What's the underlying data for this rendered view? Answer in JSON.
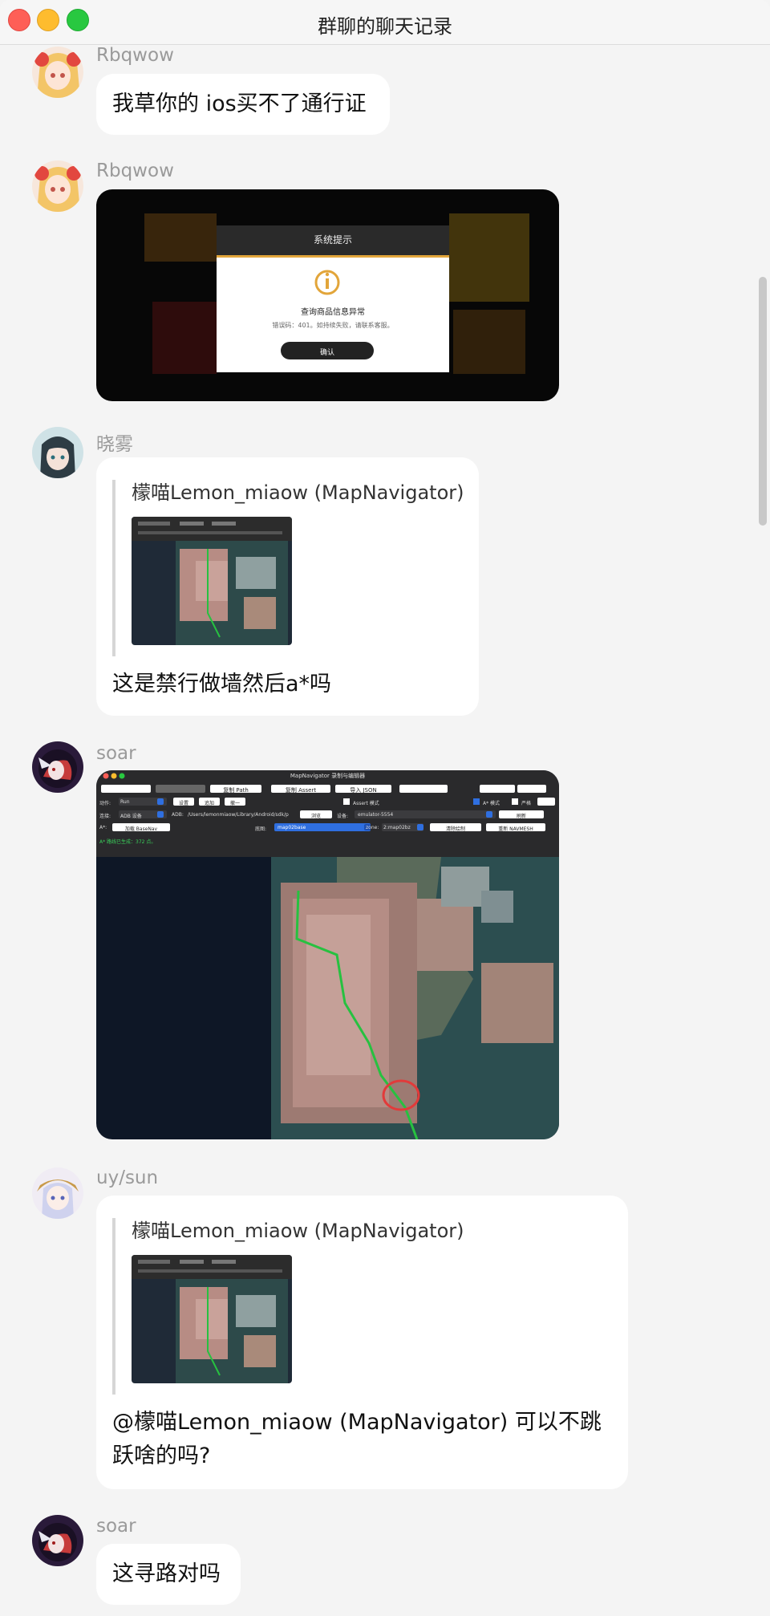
{
  "window": {
    "title": "群聊的聊天记录"
  },
  "messages": [
    {
      "sender": "Rbqwow",
      "text": "我草你的 ios买不了通行证"
    },
    {
      "sender": "Rbqwow",
      "image": {
        "dialog_title": "系统提示",
        "dialog_heading": "查询商品信息异常",
        "dialog_body": "错误码：401。如持续失败，请联系客服。",
        "confirm_label": "确认"
      }
    },
    {
      "sender": "晓雾",
      "quote_from": "檬喵Lemon_miaow (MapNavigator)",
      "text": "这是禁行做墙然后a*吗"
    },
    {
      "sender": "soar",
      "image": {
        "app_title": "MapNavigator 录制与编辑器",
        "toolbar": [
          "复制 Path",
          "复制 Assert",
          "导入 JSON"
        ],
        "row1": {
          "label_action": "动作:",
          "action_value": "Run",
          "btns": [
            "设置",
            "追加",
            "撤一"
          ],
          "assert_label": "Assert 模式",
          "astar_label": "A* 模式",
          "strict_label": "严格"
        },
        "row2": {
          "label_adb": "连接:",
          "adb_value": "ADB 设备",
          "adb_path_label": "ADB:",
          "adb_path": "/Users/lemonmiaow/Library/Android/sdk/p",
          "browse_label": "浏览",
          "device_label": "设备:",
          "device_value": "emulator-5554",
          "refresh_label": "刷新"
        },
        "row3": {
          "label_astar": "A*:",
          "basenav_label": "加载 BaseNav",
          "layer_label": "底图:",
          "layer_value": "map02base",
          "zone_label": "zone:",
          "zone_value": "2:map02bz",
          "clear_label": "清除绘制",
          "navmesh_label": "重新 NAVMESH"
        },
        "status": "A* 路线已生成：372 点。"
      }
    },
    {
      "sender": "uy/sun",
      "quote_from": "檬喵Lemon_miaow (MapNavigator)",
      "text": "@檬喵Lemon_miaow (MapNavigator) 可以不跳跃啥的吗?"
    },
    {
      "sender": "soar",
      "text": "这寻路对吗"
    }
  ],
  "colors": {
    "background": "#f4f4f4",
    "bubble": "#ffffff",
    "name": "#9a9a9a",
    "accent_blue": "#2f6fe0"
  }
}
